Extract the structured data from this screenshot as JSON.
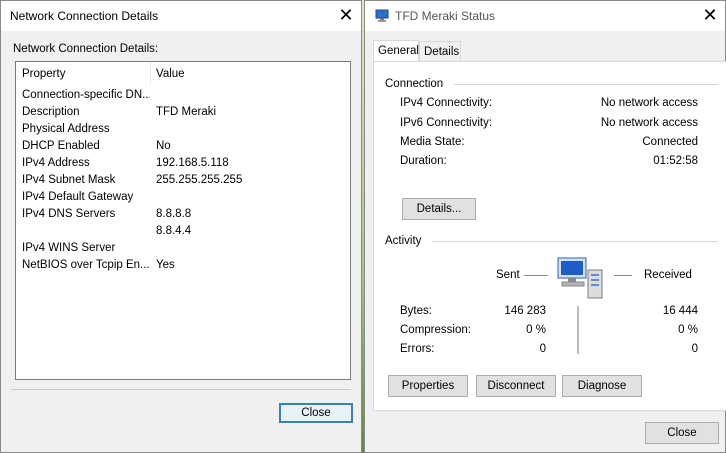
{
  "left_window": {
    "title": "Network Connection Details",
    "subtitle": "Network Connection Details:",
    "col_property": "Property",
    "col_value": "Value",
    "rows": [
      {
        "property": "Connection-specific DN...",
        "value": ""
      },
      {
        "property": "Description",
        "value": "TFD Meraki"
      },
      {
        "property": "Physical Address",
        "value": ""
      },
      {
        "property": "DHCP Enabled",
        "value": "No"
      },
      {
        "property": "IPv4 Address",
        "value": "192.168.5.118"
      },
      {
        "property": "IPv4 Subnet Mask",
        "value": "255.255.255.255"
      },
      {
        "property": "IPv4 Default Gateway",
        "value": ""
      },
      {
        "property": "IPv4 DNS Servers",
        "value": "8.8.8.8"
      },
      {
        "property": "",
        "value": "8.8.4.4"
      },
      {
        "property": "IPv4 WINS Server",
        "value": ""
      },
      {
        "property": "NetBIOS over Tcpip En...",
        "value": "Yes"
      }
    ],
    "close_label": "Close"
  },
  "right_window": {
    "title": "TFD Meraki Status",
    "tabs": [
      "General",
      "Details"
    ],
    "connection": {
      "label": "Connection",
      "rows": [
        {
          "label": "IPv4 Connectivity:",
          "value": "No network access"
        },
        {
          "label": "IPv6 Connectivity:",
          "value": "No network access"
        },
        {
          "label": "Media State:",
          "value": "Connected"
        },
        {
          "label": "Duration:",
          "value": "01:52:58"
        }
      ],
      "details_button": "Details..."
    },
    "activity": {
      "label": "Activity",
      "sent_label": "Sent",
      "received_label": "Received",
      "rows": [
        {
          "label": "Bytes:",
          "sent": "146 283",
          "received": "16 444"
        },
        {
          "label": "Compression:",
          "sent": "0 %",
          "received": "0 %"
        },
        {
          "label": "Errors:",
          "sent": "0",
          "received": "0"
        }
      ]
    },
    "buttons": {
      "properties": "Properties",
      "disconnect": "Disconnect",
      "diagnose": "Diagnose"
    },
    "close_label": "Close"
  }
}
